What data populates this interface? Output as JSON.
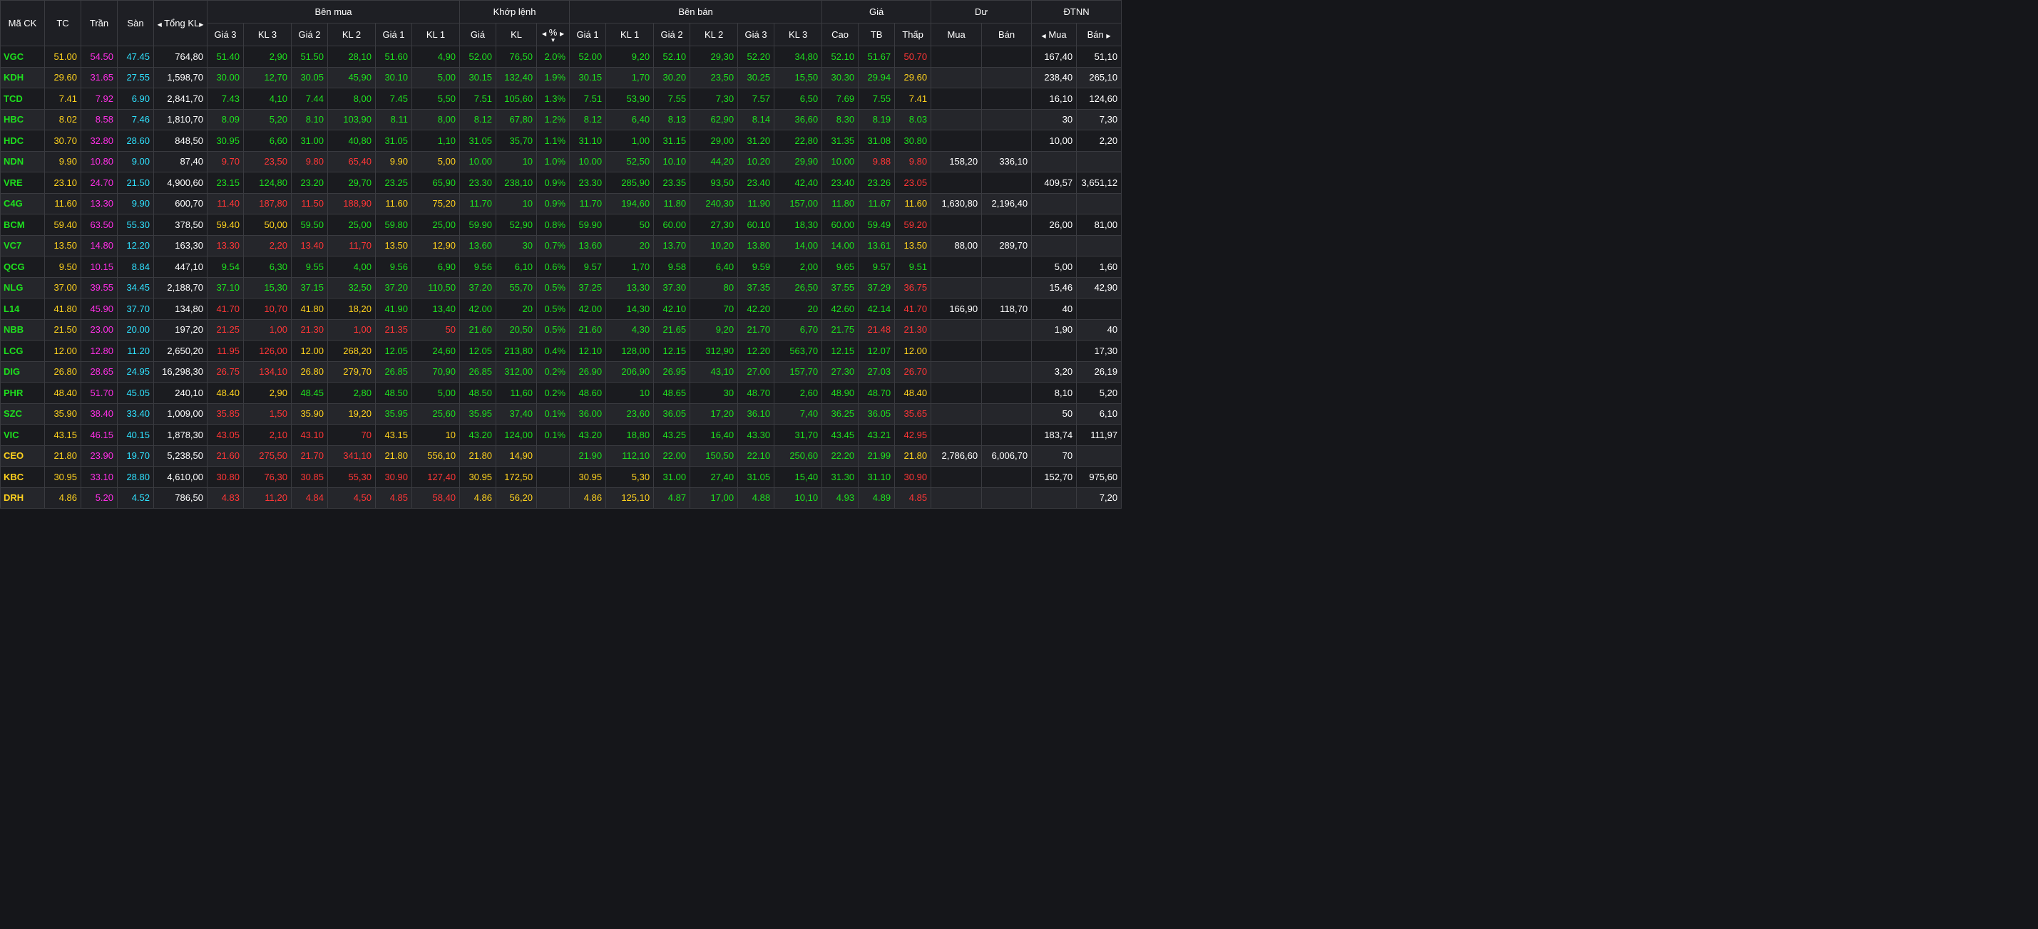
{
  "colors": {
    "up": "#1ee01e",
    "down": "#ff3636",
    "ref": "#ffd21e",
    "ceiling": "#ff2fe6",
    "floor": "#2fe2ff"
  },
  "header": {
    "symbol": "Mã CK",
    "ref": "TC",
    "ceiling": "Trần",
    "floor": "Sàn",
    "total": "Tổng KL",
    "buy": "Bên mua",
    "match": "Khớp lệnh",
    "sell": "Bên bán",
    "price": "Giá",
    "remain": "Dư",
    "foreign": "ĐTNN",
    "buy_cols": [
      "Giá 3",
      "KL 3",
      "Giá 2",
      "KL 2",
      "Giá 1",
      "KL 1"
    ],
    "match_cols": [
      "Giá",
      "KL",
      "%"
    ],
    "sell_cols": [
      "Giá 1",
      "KL 1",
      "Giá 2",
      "KL 2",
      "Giá 3",
      "KL 3"
    ],
    "price_cols": [
      "Cao",
      "TB",
      "Thấp"
    ],
    "remain_cols": [
      "Mua",
      "Bán"
    ],
    "foreign_cols": [
      "Mua",
      "Bán"
    ]
  },
  "rows": [
    {
      "sym": "VGC",
      "tc": "51.00",
      "ceil": "54.50",
      "floor": "47.45",
      "tot": "764,80",
      "b": [
        "51.40",
        "2,90",
        "51.50",
        "28,10",
        "51.60",
        "4,90"
      ],
      "m": [
        "52.00",
        "76,50",
        "2.0%"
      ],
      "s": [
        "52.00",
        "9,20",
        "52.10",
        "29,30",
        "52.20",
        "34,80"
      ],
      "p": [
        "52.10",
        "51.67",
        "50.70"
      ],
      "rb": "",
      "rs": "",
      "fb": "167,40",
      "fs": "51,10"
    },
    {
      "sym": "KDH",
      "tc": "29.60",
      "ceil": "31.65",
      "floor": "27.55",
      "tot": "1,598,70",
      "b": [
        "30.00",
        "12,70",
        "30.05",
        "45,90",
        "30.10",
        "5,00"
      ],
      "m": [
        "30.15",
        "132,40",
        "1.9%"
      ],
      "s": [
        "30.15",
        "1,70",
        "30.20",
        "23,50",
        "30.25",
        "15,50"
      ],
      "p": [
        "30.30",
        "29.94",
        "29.60"
      ],
      "rb": "",
      "rs": "",
      "fb": "238,40",
      "fs": "265,10"
    },
    {
      "sym": "TCD",
      "tc": "7.41",
      "ceil": "7.92",
      "floor": "6.90",
      "tot": "2,841,70",
      "b": [
        "7.43",
        "4,10",
        "7.44",
        "8,00",
        "7.45",
        "5,50"
      ],
      "m": [
        "7.51",
        "105,60",
        "1.3%"
      ],
      "s": [
        "7.51",
        "53,90",
        "7.55",
        "7,30",
        "7.57",
        "6,50"
      ],
      "p": [
        "7.69",
        "7.55",
        "7.41"
      ],
      "rb": "",
      "rs": "",
      "fb": "16,10",
      "fs": "124,60"
    },
    {
      "sym": "HBC",
      "tc": "8.02",
      "ceil": "8.58",
      "floor": "7.46",
      "tot": "1,810,70",
      "b": [
        "8.09",
        "5,20",
        "8.10",
        "103,90",
        "8.11",
        "8,00"
      ],
      "m": [
        "8.12",
        "67,80",
        "1.2%"
      ],
      "s": [
        "8.12",
        "6,40",
        "8.13",
        "62,90",
        "8.14",
        "36,60"
      ],
      "p": [
        "8.30",
        "8.19",
        "8.03"
      ],
      "rb": "",
      "rs": "",
      "fb": "30",
      "fs": "7,30"
    },
    {
      "sym": "HDC",
      "tc": "30.70",
      "ceil": "32.80",
      "floor": "28.60",
      "tot": "848,50",
      "b": [
        "30.95",
        "6,60",
        "31.00",
        "40,80",
        "31.05",
        "1,10"
      ],
      "m": [
        "31.05",
        "35,70",
        "1.1%"
      ],
      "s": [
        "31.10",
        "1,00",
        "31.15",
        "29,00",
        "31.20",
        "22,80"
      ],
      "p": [
        "31.35",
        "31.08",
        "30.80"
      ],
      "rb": "",
      "rs": "",
      "fb": "10,00",
      "fs": "2,20"
    },
    {
      "sym": "NDN",
      "tc": "9.90",
      "ceil": "10.80",
      "floor": "9.00",
      "tot": "87,40",
      "b": [
        "9.70",
        "23,50",
        "9.80",
        "65,40",
        "9.90",
        "5,00"
      ],
      "m": [
        "10.00",
        "10",
        "1.0%"
      ],
      "s": [
        "10.00",
        "52,50",
        "10.10",
        "44,20",
        "10.20",
        "29,90"
      ],
      "p": [
        "10.00",
        "9.88",
        "9.80"
      ],
      "rb": "158,20",
      "rs": "336,10",
      "fb": "",
      "fs": ""
    },
    {
      "sym": "VRE",
      "tc": "23.10",
      "ceil": "24.70",
      "floor": "21.50",
      "tot": "4,900,60",
      "b": [
        "23.15",
        "124,80",
        "23.20",
        "29,70",
        "23.25",
        "65,90"
      ],
      "m": [
        "23.30",
        "238,10",
        "0.9%"
      ],
      "s": [
        "23.30",
        "285,90",
        "23.35",
        "93,50",
        "23.40",
        "42,40"
      ],
      "p": [
        "23.40",
        "23.26",
        "23.05"
      ],
      "rb": "",
      "rs": "",
      "fb": "409,57",
      "fs": "3,651,12"
    },
    {
      "sym": "C4G",
      "tc": "11.60",
      "ceil": "13.30",
      "floor": "9.90",
      "tot": "600,70",
      "b": [
        "11.40",
        "187,80",
        "11.50",
        "188,90",
        "11.60",
        "75,20"
      ],
      "m": [
        "11.70",
        "10",
        "0.9%"
      ],
      "s": [
        "11.70",
        "194,60",
        "11.80",
        "240,30",
        "11.90",
        "157,00"
      ],
      "p": [
        "11.80",
        "11.67",
        "11.60"
      ],
      "rb": "1,630,80",
      "rs": "2,196,40",
      "fb": "",
      "fs": ""
    },
    {
      "sym": "BCM",
      "tc": "59.40",
      "ceil": "63.50",
      "floor": "55.30",
      "tot": "378,50",
      "b": [
        "59.40",
        "50,00",
        "59.50",
        "25,00",
        "59.80",
        "25,00"
      ],
      "m": [
        "59.90",
        "52,90",
        "0.8%"
      ],
      "s": [
        "59.90",
        "50",
        "60.00",
        "27,30",
        "60.10",
        "18,30"
      ],
      "p": [
        "60.00",
        "59.49",
        "59.20"
      ],
      "rb": "",
      "rs": "",
      "fb": "26,00",
      "fs": "81,00"
    },
    {
      "sym": "VC7",
      "tc": "13.50",
      "ceil": "14.80",
      "floor": "12.20",
      "tot": "163,30",
      "b": [
        "13.30",
        "2,20",
        "13.40",
        "11,70",
        "13.50",
        "12,90"
      ],
      "m": [
        "13.60",
        "30",
        "0.7%"
      ],
      "s": [
        "13.60",
        "20",
        "13.70",
        "10,20",
        "13.80",
        "14,00"
      ],
      "p": [
        "14.00",
        "13.61",
        "13.50"
      ],
      "rb": "88,00",
      "rs": "289,70",
      "fb": "",
      "fs": ""
    },
    {
      "sym": "QCG",
      "tc": "9.50",
      "ceil": "10.15",
      "floor": "8.84",
      "tot": "447,10",
      "b": [
        "9.54",
        "6,30",
        "9.55",
        "4,00",
        "9.56",
        "6,90"
      ],
      "m": [
        "9.56",
        "6,10",
        "0.6%"
      ],
      "s": [
        "9.57",
        "1,70",
        "9.58",
        "6,40",
        "9.59",
        "2,00"
      ],
      "p": [
        "9.65",
        "9.57",
        "9.51"
      ],
      "rb": "",
      "rs": "",
      "fb": "5,00",
      "fs": "1,60"
    },
    {
      "sym": "NLG",
      "tc": "37.00",
      "ceil": "39.55",
      "floor": "34.45",
      "tot": "2,188,70",
      "b": [
        "37.10",
        "15,30",
        "37.15",
        "32,50",
        "37.20",
        "110,50"
      ],
      "m": [
        "37.20",
        "55,70",
        "0.5%"
      ],
      "s": [
        "37.25",
        "13,30",
        "37.30",
        "80",
        "37.35",
        "26,50"
      ],
      "p": [
        "37.55",
        "37.29",
        "36.75"
      ],
      "rb": "",
      "rs": "",
      "fb": "15,46",
      "fs": "42,90"
    },
    {
      "sym": "L14",
      "tc": "41.80",
      "ceil": "45.90",
      "floor": "37.70",
      "tot": "134,80",
      "b": [
        "41.70",
        "10,70",
        "41.80",
        "18,20",
        "41.90",
        "13,40"
      ],
      "m": [
        "42.00",
        "20",
        "0.5%"
      ],
      "s": [
        "42.00",
        "14,30",
        "42.10",
        "70",
        "42.20",
        "20"
      ],
      "p": [
        "42.60",
        "42.14",
        "41.70"
      ],
      "rb": "166,90",
      "rs": "118,70",
      "fb": "40",
      "fs": ""
    },
    {
      "sym": "NBB",
      "tc": "21.50",
      "ceil": "23.00",
      "floor": "20.00",
      "tot": "197,20",
      "b": [
        "21.25",
        "1,00",
        "21.30",
        "1,00",
        "21.35",
        "50"
      ],
      "m": [
        "21.60",
        "20,50",
        "0.5%"
      ],
      "s": [
        "21.60",
        "4,30",
        "21.65",
        "9,20",
        "21.70",
        "6,70"
      ],
      "p": [
        "21.75",
        "21.48",
        "21.30"
      ],
      "rb": "",
      "rs": "",
      "fb": "1,90",
      "fs": "40"
    },
    {
      "sym": "LCG",
      "tc": "12.00",
      "ceil": "12.80",
      "floor": "11.20",
      "tot": "2,650,20",
      "b": [
        "11.95",
        "126,00",
        "12.00",
        "268,20",
        "12.05",
        "24,60"
      ],
      "m": [
        "12.05",
        "213,80",
        "0.4%"
      ],
      "s": [
        "12.10",
        "128,00",
        "12.15",
        "312,90",
        "12.20",
        "563,70"
      ],
      "p": [
        "12.15",
        "12.07",
        "12.00"
      ],
      "rb": "",
      "rs": "",
      "fb": "",
      "fs": "17,30"
    },
    {
      "sym": "DIG",
      "tc": "26.80",
      "ceil": "28.65",
      "floor": "24.95",
      "tot": "16,298,30",
      "b": [
        "26.75",
        "134,10",
        "26.80",
        "279,70",
        "26.85",
        "70,90"
      ],
      "m": [
        "26.85",
        "312,00",
        "0.2%"
      ],
      "s": [
        "26.90",
        "206,90",
        "26.95",
        "43,10",
        "27.00",
        "157,70"
      ],
      "p": [
        "27.30",
        "27.03",
        "26.70"
      ],
      "rb": "",
      "rs": "",
      "fb": "3,20",
      "fs": "26,19"
    },
    {
      "sym": "PHR",
      "tc": "48.40",
      "ceil": "51.70",
      "floor": "45.05",
      "tot": "240,10",
      "b": [
        "48.40",
        "2,90",
        "48.45",
        "2,80",
        "48.50",
        "5,00"
      ],
      "m": [
        "48.50",
        "11,60",
        "0.2%"
      ],
      "s": [
        "48.60",
        "10",
        "48.65",
        "30",
        "48.70",
        "2,60"
      ],
      "p": [
        "48.90",
        "48.70",
        "48.40"
      ],
      "rb": "",
      "rs": "",
      "fb": "8,10",
      "fs": "5,20"
    },
    {
      "sym": "SZC",
      "tc": "35.90",
      "ceil": "38.40",
      "floor": "33.40",
      "tot": "1,009,00",
      "b": [
        "35.85",
        "1,50",
        "35.90",
        "19,20",
        "35.95",
        "25,60"
      ],
      "m": [
        "35.95",
        "37,40",
        "0.1%"
      ],
      "s": [
        "36.00",
        "23,60",
        "36.05",
        "17,20",
        "36.10",
        "7,40"
      ],
      "p": [
        "36.25",
        "36.05",
        "35.65"
      ],
      "rb": "",
      "rs": "",
      "fb": "50",
      "fs": "6,10"
    },
    {
      "sym": "VIC",
      "tc": "43.15",
      "ceil": "46.15",
      "floor": "40.15",
      "tot": "1,878,30",
      "b": [
        "43.05",
        "2,10",
        "43.10",
        "70",
        "43.15",
        "10"
      ],
      "m": [
        "43.20",
        "124,00",
        "0.1%"
      ],
      "s": [
        "43.20",
        "18,80",
        "43.25",
        "16,40",
        "43.30",
        "31,70"
      ],
      "p": [
        "43.45",
        "43.21",
        "42.95"
      ],
      "rb": "",
      "rs": "",
      "fb": "183,74",
      "fs": "111,97"
    },
    {
      "sym": "CEO",
      "tc": "21.80",
      "ceil": "23.90",
      "floor": "19.70",
      "tot": "5,238,50",
      "b": [
        "21.60",
        "275,50",
        "21.70",
        "341,10",
        "21.80",
        "556,10"
      ],
      "m": [
        "21.80",
        "14,90",
        ""
      ],
      "s": [
        "21.90",
        "112,10",
        "22.00",
        "150,50",
        "22.10",
        "250,60"
      ],
      "p": [
        "22.20",
        "21.99",
        "21.80"
      ],
      "rb": "2,786,60",
      "rs": "6,006,70",
      "fb": "70",
      "fs": ""
    },
    {
      "sym": "KBC",
      "tc": "30.95",
      "ceil": "33.10",
      "floor": "28.80",
      "tot": "4,610,00",
      "b": [
        "30.80",
        "76,30",
        "30.85",
        "55,30",
        "30.90",
        "127,40"
      ],
      "m": [
        "30.95",
        "172,50",
        ""
      ],
      "s": [
        "30.95",
        "5,30",
        "31.00",
        "27,40",
        "31.05",
        "15,40"
      ],
      "p": [
        "31.30",
        "31.10",
        "30.90"
      ],
      "rb": "",
      "rs": "",
      "fb": "152,70",
      "fs": "975,60"
    },
    {
      "sym": "DRH",
      "tc": "4.86",
      "ceil": "5.20",
      "floor": "4.52",
      "tot": "786,50",
      "b": [
        "4.83",
        "11,20",
        "4.84",
        "4,50",
        "4.85",
        "58,40"
      ],
      "m": [
        "4.86",
        "56,20",
        ""
      ],
      "s": [
        "4.86",
        "125,10",
        "4.87",
        "17,00",
        "4.88",
        "10,10"
      ],
      "p": [
        "4.93",
        "4.89",
        "4.85"
      ],
      "rb": "",
      "rs": "",
      "fb": "",
      "fs": "7,20"
    }
  ]
}
